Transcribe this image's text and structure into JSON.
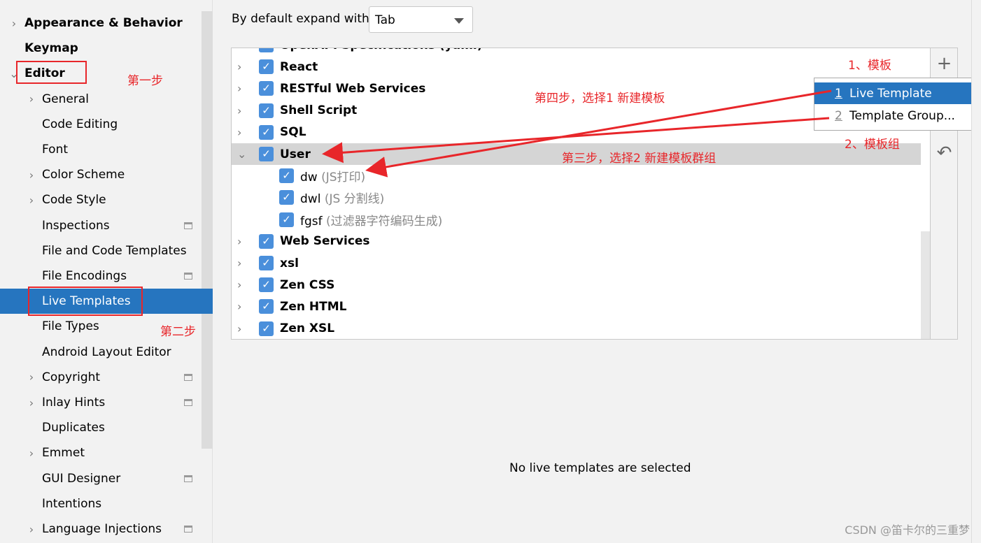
{
  "sidebar": {
    "items": [
      {
        "label": "Appearance & Behavior",
        "level": 0,
        "chevron": "right",
        "bold": true
      },
      {
        "label": "Keymap",
        "level": 0,
        "chevron": "none",
        "bold": true
      },
      {
        "label": "Editor",
        "level": 0,
        "chevron": "down",
        "bold": true
      },
      {
        "label": "General",
        "level": 1,
        "chevron": "right"
      },
      {
        "label": "Code Editing",
        "level": 1,
        "chevron": "none"
      },
      {
        "label": "Font",
        "level": 1,
        "chevron": "none"
      },
      {
        "label": "Color Scheme",
        "level": 1,
        "chevron": "right"
      },
      {
        "label": "Code Style",
        "level": 1,
        "chevron": "right"
      },
      {
        "label": "Inspections",
        "level": 1,
        "chevron": "none",
        "badge": true
      },
      {
        "label": "File and Code Templates",
        "level": 1,
        "chevron": "none"
      },
      {
        "label": "File Encodings",
        "level": 1,
        "chevron": "none",
        "badge": true
      },
      {
        "label": "Live Templates",
        "level": 1,
        "chevron": "none",
        "selected": true
      },
      {
        "label": "File Types",
        "level": 1,
        "chevron": "none"
      },
      {
        "label": "Android Layout Editor",
        "level": 1,
        "chevron": "none"
      },
      {
        "label": "Copyright",
        "level": 1,
        "chevron": "right",
        "badge": true
      },
      {
        "label": "Inlay Hints",
        "level": 1,
        "chevron": "right",
        "badge": true
      },
      {
        "label": "Duplicates",
        "level": 1,
        "chevron": "none"
      },
      {
        "label": "Emmet",
        "level": 1,
        "chevron": "right"
      },
      {
        "label": "GUI Designer",
        "level": 1,
        "chevron": "none",
        "badge": true
      },
      {
        "label": "Intentions",
        "level": 1,
        "chevron": "none"
      },
      {
        "label": "Language Injections",
        "level": 1,
        "chevron": "right",
        "badge": true
      }
    ]
  },
  "expand": {
    "label": "By default expand with",
    "value": "Tab"
  },
  "tree": {
    "rows": [
      {
        "name": "OpenAPI Specifications (yaml)",
        "level": 0,
        "checked": true
      },
      {
        "name": "React",
        "level": 0,
        "checked": true
      },
      {
        "name": "RESTful Web Services",
        "level": 0,
        "checked": true
      },
      {
        "name": "Shell Script",
        "level": 0,
        "checked": true
      },
      {
        "name": "SQL",
        "level": 0,
        "checked": true
      },
      {
        "name": "User",
        "level": 0,
        "checked": true,
        "expanded": true,
        "highlight": true
      },
      {
        "name": "dw",
        "desc": "(JS打印)",
        "level": 1,
        "checked": true
      },
      {
        "name": "dwl",
        "desc": "(JS 分割线)",
        "level": 1,
        "checked": true
      },
      {
        "name": "fgsf",
        "desc": "(过滤器字符编码生成)",
        "level": 1,
        "checked": true
      },
      {
        "name": "Web Services",
        "level": 0,
        "checked": true
      },
      {
        "name": "xsl",
        "level": 0,
        "checked": true
      },
      {
        "name": "Zen CSS",
        "level": 0,
        "checked": true
      },
      {
        "name": "Zen HTML",
        "level": 0,
        "checked": true
      },
      {
        "name": "Zen XSL",
        "level": 0,
        "checked": true
      }
    ]
  },
  "tools": {
    "add": "+",
    "revert": "↶"
  },
  "menu": {
    "items": [
      {
        "num": "1",
        "label": "Live Template",
        "selected": true
      },
      {
        "num": "2",
        "label": "Template Group..."
      }
    ]
  },
  "empty_text": "No live templates are selected",
  "annotations": {
    "step1": "第一步",
    "step2": "第二步",
    "step3": "第三步，选择2  新建模板群组",
    "step4": "第四步，选择1  新建模板",
    "tpl": "1、模板",
    "grp": "2、模板组"
  },
  "watermark": "CSDN @笛卡尔的三重梦",
  "colors": {
    "accent": "#2675bf",
    "checkbox": "#4a8fdb",
    "annotation": "#e8262a"
  }
}
